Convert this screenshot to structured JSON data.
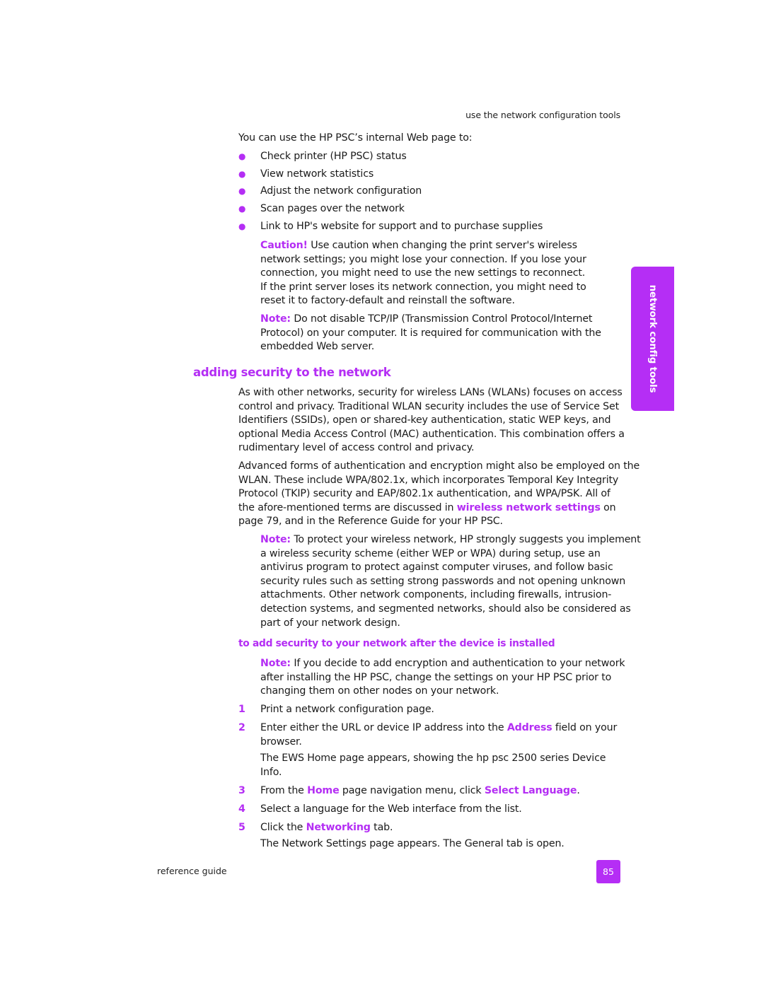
{
  "running_header": "use the network configuration tools",
  "intro": "You can use the HP PSC’s internal Web page to:",
  "bullets": [
    "Check printer (HP PSC) status",
    "View network statistics",
    "Adjust the network configuration",
    "Scan pages over the network",
    "Link to HP's website for support and to purchase supplies"
  ],
  "caution": {
    "label": "Caution!",
    "lines": [
      " Use caution when changing the print server's wireless",
      "network settings; you might lose your connection. If you lose your",
      "connection, you might need to use the new settings to reconnect.",
      "If the print server loses its network connection, you might need to",
      "reset it to factory-default and reinstall the software."
    ]
  },
  "note1": {
    "label": "Note:",
    "lines": [
      " Do not disable TCP/IP (Transmission Control Protocol/Internet",
      "Protocol) on your computer. It is required for communication with the",
      "embedded Web server."
    ]
  },
  "section_heading": "adding security to the network",
  "para1": [
    "As with other networks, security for wireless LANs (WLANs) focuses on access",
    "control and privacy. Traditional WLAN security includes the use of Service Set",
    "Identifiers (SSIDs), open or shared-key authentication, static WEP keys, and",
    "optional Media Access Control (MAC) authentication. This combination offers a",
    "rudimentary level of access control and privacy."
  ],
  "para2": {
    "lines": [
      "Advanced forms of authentication and encryption might also be employed on the",
      "WLAN. These include WPA/802.1x, which incorporates Temporal Key Integrity",
      "Protocol (TKIP) security and EAP/802.1x authentication, and WPA/PSK. All of"
    ],
    "line4_before": "the afore-mentioned terms are discussed in ",
    "line4_link": "wireless network settings",
    "line4_after": " on",
    "line5": "page 79, and in the Reference Guide for your HP PSC."
  },
  "note2": {
    "label": "Note:",
    "lines": [
      " To protect your wireless network, HP strongly suggests you implement",
      "a wireless security scheme (either WEP or WPA) during setup, use an",
      "antivirus program to protect against computer viruses, and follow basic",
      "security rules such as setting strong passwords and not opening unknown",
      "attachments. Other network components, including firewalls, intrusion-",
      "detection systems, and segmented networks, should also be considered as",
      "part of your network design."
    ]
  },
  "sub_heading": "to add security to your network after the device is installed",
  "note3": {
    "label": "Note:",
    "lines": [
      " If you decide to add encryption and authentication to your network",
      "after installing the HP PSC, change the settings on your HP PSC prior to",
      "changing them on other nodes on your network."
    ]
  },
  "steps": [
    {
      "num": "1",
      "text": "Print a network configuration page."
    },
    {
      "num": "2",
      "before": "Enter either the URL or device IP address into the ",
      "link": "Address",
      "after": " field on your",
      "cont": "browser.",
      "result": [
        "The EWS Home page appears, showing the hp psc 2500 series Device",
        "Info."
      ]
    },
    {
      "num": "3",
      "before": "From the ",
      "link": "Home",
      "mid": " page navigation menu, click ",
      "link2": "Select Language",
      "after": "."
    },
    {
      "num": "4",
      "text": "Select a language for the Web interface from the list."
    },
    {
      "num": "5",
      "before": "Click the ",
      "link": "Networking",
      "after": " tab.",
      "result": [
        "The Network Settings page appears. The General tab is open."
      ]
    }
  ],
  "side_tab": "network config tools",
  "footer": {
    "left": "reference guide",
    "page_number": "85"
  },
  "colors": {
    "accent": "#b42ef4",
    "text": "#1a1a1a",
    "background": "#ffffff"
  }
}
